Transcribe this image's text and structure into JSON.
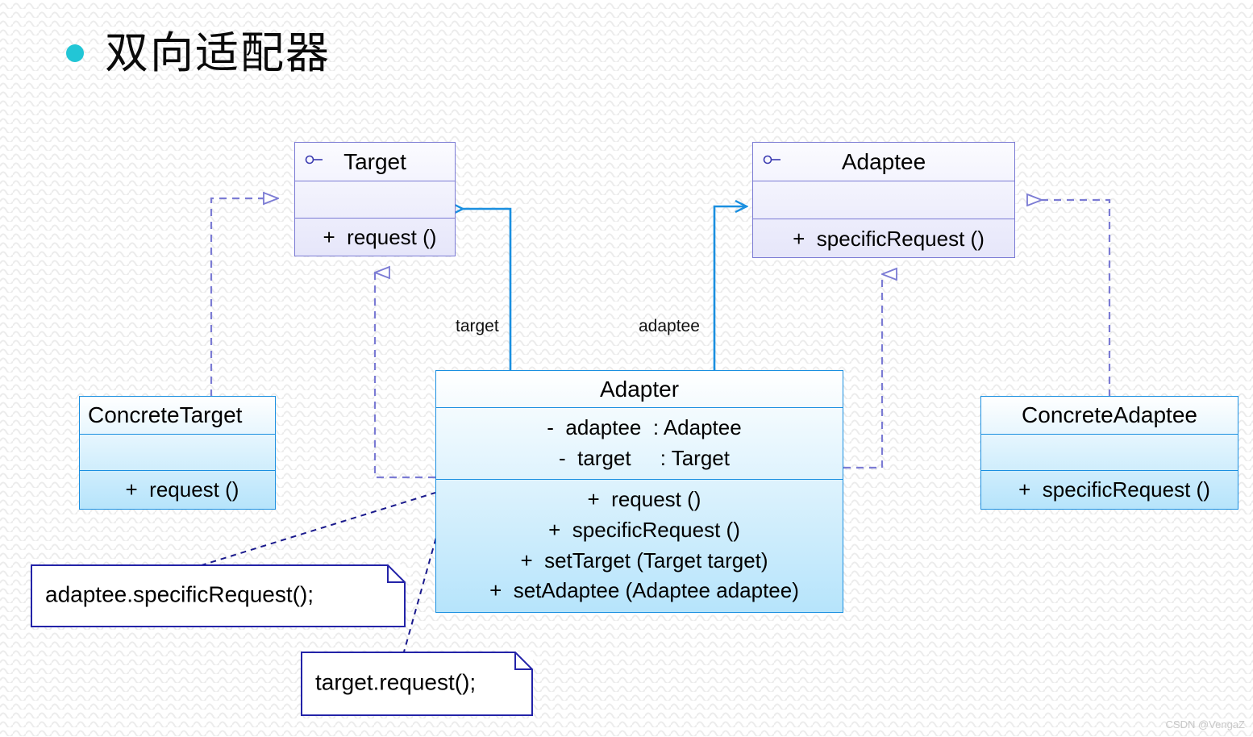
{
  "slide": {
    "title": "双向适配器",
    "bullet_color": "#22c6d6",
    "watermark": "CSDN @VengaZ"
  },
  "colors": {
    "interface_border": "#7b7bd4",
    "interface_fill_top": "#fbfbff",
    "interface_fill_bottom": "#e6e6fa",
    "class_border": "#1a8fe0",
    "class_fill_top": "#ffffff",
    "class_fill_bottom": "#b6e4fb",
    "association_line": "#1a8fe0",
    "realization_line": "#7b7bd4",
    "note_border": "#2323a8",
    "note_link": "#1a1a8c",
    "background": "#ffffff"
  },
  "classes": {
    "target": {
      "name": "Target",
      "stereotype_icon": "interface-lollipop-icon",
      "kind": "interface",
      "attributes": [],
      "operations": [
        "+  request ()"
      ]
    },
    "adaptee": {
      "name": "Adaptee",
      "stereotype_icon": "interface-lollipop-icon",
      "kind": "interface",
      "attributes": [],
      "operations": [
        "+  specificRequest ()"
      ]
    },
    "adapter": {
      "name": "Adapter",
      "kind": "class",
      "attributes": [
        "-  adaptee  : Adaptee",
        "-  target     : Target"
      ],
      "operations": [
        "+  request ()",
        "+  specificRequest ()",
        "+  setTarget (Target target)",
        "+  setAdaptee (Adaptee adaptee)"
      ]
    },
    "concrete_target": {
      "name": "ConcreteTarget",
      "kind": "class",
      "attributes": [],
      "operations": [
        "+  request ()"
      ]
    },
    "concrete_adaptee": {
      "name": "ConcreteAdaptee",
      "kind": "class",
      "attributes": [],
      "operations": [
        "+  specificRequest ()"
      ]
    }
  },
  "edge_labels": {
    "target_role": "target",
    "adaptee_role": "adaptee"
  },
  "notes": [
    {
      "text": "adaptee.specificRequest();",
      "attached_to": "Adapter.request ()"
    },
    {
      "text": "target.request();",
      "attached_to": "Adapter.specificRequest ()"
    }
  ],
  "relationships": [
    {
      "type": "realization",
      "from": "ConcreteTarget",
      "to": "Target"
    },
    {
      "type": "realization",
      "from": "Adapter",
      "to": "Target"
    },
    {
      "type": "realization",
      "from": "Adapter",
      "to": "Adaptee"
    },
    {
      "type": "realization",
      "from": "ConcreteAdaptee",
      "to": "Adaptee"
    },
    {
      "type": "association",
      "from": "Adapter",
      "to": "Target",
      "role": "target"
    },
    {
      "type": "association",
      "from": "Adapter",
      "to": "Adaptee",
      "role": "adaptee"
    }
  ]
}
